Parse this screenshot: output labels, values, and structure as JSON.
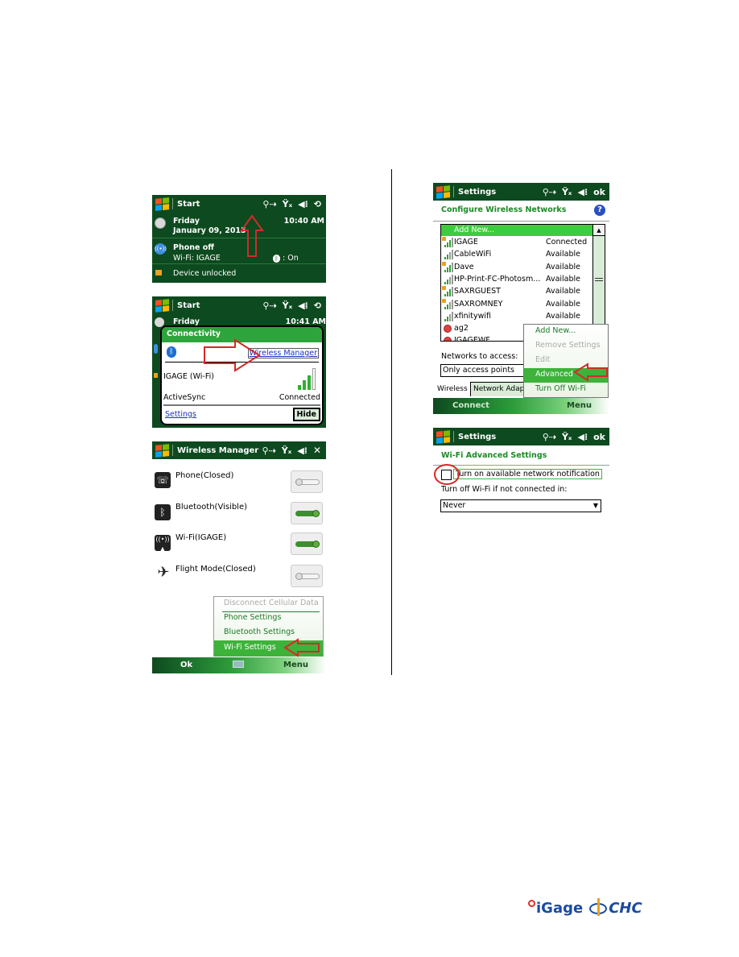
{
  "status_icons": {
    "connectivity": "connectivity-icon",
    "signal": "signal-off-icon",
    "volume": "volume-icon",
    "sync": "activesync-icon"
  },
  "screen1": {
    "title": "Start",
    "day": "Friday",
    "date": "January 09, 2015",
    "time": "10:40 AM",
    "phone_status": "Phone off",
    "wifi_status": "Wi-Fi: IGAGE",
    "bluetooth_status": ": On",
    "lock_status": "Device unlocked"
  },
  "screen2": {
    "title": "Start",
    "day": "Friday",
    "time": "10:41 AM",
    "popup_title": "Connectivity",
    "wireless_manager_link": "Wireless Manager",
    "wifi_label": "IGAGE (Wi-Fi)",
    "activesync_label": "ActiveSync",
    "activesync_status": "Connected",
    "settings_link": "Settings",
    "hide_button": "Hide"
  },
  "screen3": {
    "title": "Wireless Manager",
    "close": "✕",
    "items": [
      {
        "label": "Phone(Closed)",
        "icon": "phone-icon",
        "on": false
      },
      {
        "label": "Bluetooth(Visible)",
        "icon": "bluetooth-icon",
        "on": true
      },
      {
        "label": "Wi-Fi(IGAGE)",
        "icon": "wifi-icon",
        "on": true
      },
      {
        "label": "Flight Mode(Closed)",
        "icon": "airplane-icon",
        "on": false
      }
    ],
    "menu": [
      {
        "label": "Disconnect Cellular Data",
        "disabled": true
      },
      {
        "label": "Phone Settings",
        "disabled": false
      },
      {
        "label": "Bluetooth Settings",
        "disabled": false
      },
      {
        "label": "Wi-Fi Settings",
        "disabled": false,
        "selected": true
      }
    ],
    "softkey_left": "Ok",
    "softkey_right": "Menu"
  },
  "screen4": {
    "title": "Settings",
    "ok": "ok",
    "heading": "Configure Wireless Networks",
    "add_new": "Add New...",
    "networks": [
      {
        "name": "IGAGE",
        "status": "Connected",
        "secured": true,
        "signal": 3
      },
      {
        "name": "CableWiFi",
        "status": "Available",
        "secured": false,
        "signal": 2
      },
      {
        "name": "Dave",
        "status": "Available",
        "secured": true,
        "signal": 3
      },
      {
        "name": "HP-Print-FC-Photosm...",
        "status": "Available",
        "secured": false,
        "signal": 2
      },
      {
        "name": "SAXRGUEST",
        "status": "Available",
        "secured": true,
        "signal": 3
      },
      {
        "name": "SAXROMNEY",
        "status": "Available",
        "secured": true,
        "signal": 2
      },
      {
        "name": "xfinitywifi",
        "status": "Available",
        "secured": false,
        "signal": 2
      },
      {
        "name": "ag2",
        "status": "",
        "secured": false,
        "signal": 0,
        "unavailable": true
      },
      {
        "name": "IGAGEWF",
        "status": "",
        "secured": false,
        "signal": 0,
        "unavailable": true
      }
    ],
    "networks_to_access_label": "Networks to access:",
    "networks_to_access_value": "Only access points",
    "tabs": [
      "Wireless",
      "Network Adapt"
    ],
    "menu": [
      {
        "label": "Add New...",
        "disabled": false
      },
      {
        "label": "Remove Settings",
        "disabled": true
      },
      {
        "label": "Edit",
        "disabled": true
      },
      {
        "label": "Advanced",
        "disabled": false,
        "selected": true
      },
      {
        "label": "Turn Off Wi-Fi",
        "disabled": false
      }
    ],
    "softkey_left": "Connect",
    "softkey_right": "Menu"
  },
  "screen5": {
    "title": "Settings",
    "ok": "ok",
    "heading": "Wi-Fi Advanced Settings",
    "checkbox_label": "Turn on available network notification",
    "checkbox_checked": false,
    "turnoff_label": "Turn off Wi-Fi if not connected in:",
    "turnoff_value": "Never"
  },
  "footer": {
    "logo1": "iGage",
    "logo2": "CHC"
  }
}
